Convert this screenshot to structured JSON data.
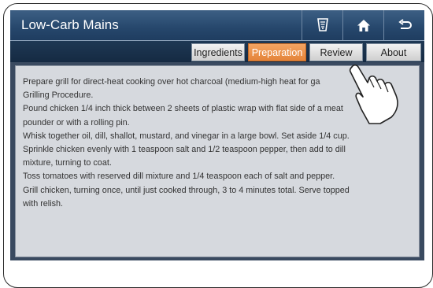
{
  "header": {
    "title": "Low-Carb Mains",
    "buttons": [
      {
        "name": "recipe-icon"
      },
      {
        "name": "home-icon"
      },
      {
        "name": "back-icon"
      }
    ]
  },
  "tabs": [
    {
      "label": "Ingredients",
      "active": false
    },
    {
      "label": "Preparation",
      "active": true
    },
    {
      "label": "Review",
      "active": false
    },
    {
      "label": "About",
      "active": false
    }
  ],
  "content": {
    "lines": [
      "Prepare grill for direct-heat cooking over hot charcoal (medium-high heat for ga",
      "Grilling Procedure.",
      "Pound chicken 1/4 inch thick between 2 sheets of plastic wrap with flat side of a meat",
      "pounder or with a rolling pin.",
      "Whisk together oil, dill, shallot, mustard, and vinegar in a large bowl. Set aside 1/4 cup.",
      "Sprinkle chicken evenly with 1 teaspoon salt and 1/2 teaspoon pepper, then add to dill",
      "mixture, turning to coat.",
      "Toss tomatoes with reserved dill mixture and 1/4 teaspoon each of salt and pepper.",
      "Grill chicken, turning once, until just cooked through, 3 to 4 minutes total. Serve topped",
      "with relish."
    ]
  },
  "colors": {
    "title_bar": "#26476c",
    "active_tab": "#e4843a",
    "content_bg": "#d6d9de"
  }
}
